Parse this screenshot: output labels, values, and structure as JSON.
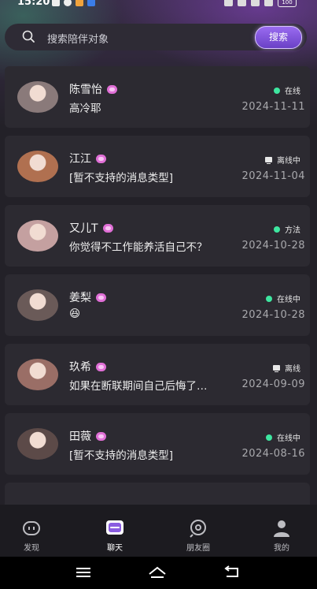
{
  "status_bar": {
    "time": "15:20",
    "battery": "100"
  },
  "search": {
    "placeholder": "搜索陪伴对象",
    "button_label": "搜索"
  },
  "conversations": [
    {
      "name": "陈雪怡",
      "message": "高冷耶",
      "status": "在线",
      "status_type": "online",
      "date": "2024-11-11",
      "avatar_color": "#8a7a7a"
    },
    {
      "name": "江江",
      "message": "[暂不支持的消息类型]",
      "status": "离线中",
      "status_type": "offline",
      "date": "2024-11-04",
      "avatar_color": "#b07050"
    },
    {
      "name": "又儿T",
      "message": "你觉得不工作能养活自己不？",
      "status": "方法",
      "status_type": "online",
      "date": "2024-10-28",
      "avatar_color": "#c4a0a0"
    },
    {
      "name": "姜梨",
      "message": "😆",
      "status": "在线中",
      "status_type": "online",
      "date": "2024-10-28",
      "avatar_color": "#6a5a58"
    },
    {
      "name": "玖希",
      "message": "如果在断联期间自己后悔了…",
      "status": "离线",
      "status_type": "offline",
      "date": "2024-09-09",
      "avatar_color": "#9a6e66"
    },
    {
      "name": "田薇",
      "message": "[暂不支持的消息类型]",
      "status": "在线中",
      "status_type": "online",
      "date": "2024-08-16",
      "avatar_color": "#5c4a48"
    }
  ],
  "tabs": [
    {
      "label": "发现",
      "icon": "robot-icon",
      "active": false
    },
    {
      "label": "聊天",
      "icon": "chat-icon",
      "active": true
    },
    {
      "label": "朋友圈",
      "icon": "moments-icon",
      "active": false
    },
    {
      "label": "我的",
      "icon": "profile-icon",
      "active": false
    }
  ],
  "colors": {
    "accent": "#8a5ce0",
    "online_dot": "#3ee6a0",
    "card_bg": "#2c2a31"
  }
}
